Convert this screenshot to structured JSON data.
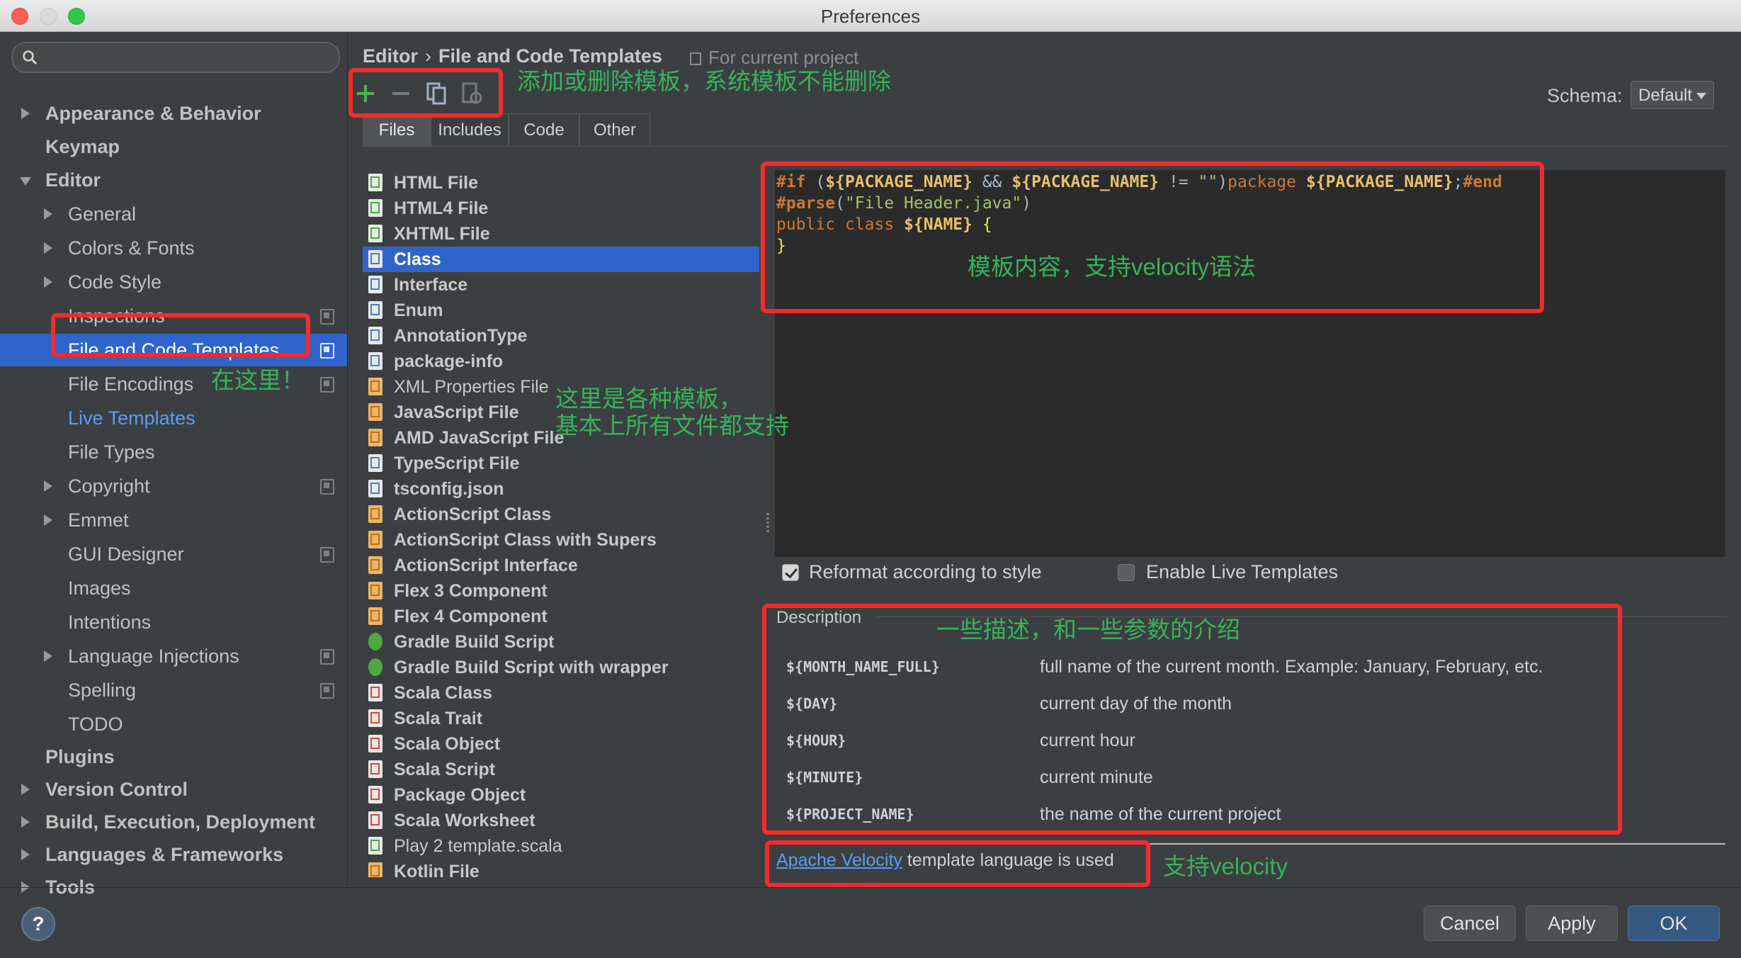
{
  "window": {
    "title": "Preferences"
  },
  "search": {
    "placeholder": ""
  },
  "sidebar": {
    "items": [
      {
        "label": "Appearance & Behavior"
      },
      {
        "label": "Keymap"
      },
      {
        "label": "Editor"
      },
      {
        "label": "General"
      },
      {
        "label": "Colors & Fonts"
      },
      {
        "label": "Code Style"
      },
      {
        "label": "Inspections"
      },
      {
        "label": "File and Code Templates"
      },
      {
        "label": "File Encodings"
      },
      {
        "label": "Live Templates"
      },
      {
        "label": "File Types"
      },
      {
        "label": "Copyright"
      },
      {
        "label": "Emmet"
      },
      {
        "label": "GUI Designer"
      },
      {
        "label": "Images"
      },
      {
        "label": "Intentions"
      },
      {
        "label": "Language Injections"
      },
      {
        "label": "Spelling"
      },
      {
        "label": "TODO"
      },
      {
        "label": "Plugins"
      },
      {
        "label": "Version Control"
      },
      {
        "label": "Build, Execution, Deployment"
      },
      {
        "label": "Languages & Frameworks"
      },
      {
        "label": "Tools"
      }
    ]
  },
  "breadcrumb": {
    "parent": "Editor",
    "separator": "›",
    "current": "File and Code Templates",
    "scope": "For current project"
  },
  "schema": {
    "label": "Schema:",
    "value": "Default"
  },
  "tabs": [
    {
      "label": "Files"
    },
    {
      "label": "Includes"
    },
    {
      "label": "Code"
    },
    {
      "label": "Other"
    }
  ],
  "templates": [
    "HTML File",
    "HTML4 File",
    "XHTML File",
    "Class",
    "Interface",
    "Enum",
    "AnnotationType",
    "package-info",
    "XML Properties File",
    "JavaScript File",
    "AMD JavaScript File",
    "TypeScript File",
    "tsconfig.json",
    "ActionScript Class",
    "ActionScript Class with Supers",
    "ActionScript Interface",
    "Flex 3 Component",
    "Flex 4 Component",
    "Gradle Build Script",
    "Gradle Build Script with wrapper",
    "Scala Class",
    "Scala Trait",
    "Scala Object",
    "Scala Script",
    "Package Object",
    "Scala Worksheet",
    "Play 2 template.scala",
    "Kotlin File"
  ],
  "editor": {
    "if_directive": "#if",
    "package_var": "${PACKAGE_NAME}",
    "and_op": "&&",
    "neq_op": "!=",
    "empty_string": "\"\"",
    "package_kw": "package",
    "end_directive": "#end",
    "parse_directive": "#parse",
    "parse_arg": "\"File Header.java\"",
    "public_kw": "public",
    "class_kw": "class",
    "name_var": "${NAME}",
    "open_brace": "{",
    "close_brace": "}"
  },
  "options": {
    "reformat": "Reformat according to style",
    "reformat_checked": true,
    "live_templates": "Enable Live Templates",
    "live_templates_checked": false
  },
  "description": {
    "title": "Description",
    "rows": [
      {
        "var": "${MONTH_NAME_FULL}",
        "text": "full name of the current month. Example: January, February, etc."
      },
      {
        "var": "${DAY}",
        "text": "current day of the month"
      },
      {
        "var": "${HOUR}",
        "text": "current hour"
      },
      {
        "var": "${MINUTE}",
        "text": "current minute"
      },
      {
        "var": "${PROJECT_NAME}",
        "text": "the name of the current project"
      }
    ]
  },
  "velocity": {
    "link": "Apache Velocity",
    "text": " template language is used"
  },
  "buttons": {
    "help": "?",
    "cancel": "Cancel",
    "apply": "Apply",
    "ok": "OK"
  },
  "annotations": {
    "toolbar_note": "添加或删除模板，系统模板不能删除",
    "here_note": "在这里！",
    "templates_note_1": "这里是各种模板，",
    "templates_note_2": "基本上所有文件都支持",
    "editor_note": "模板内容，支持velocity语法",
    "desc_note": "一些描述，和一些参数的介绍",
    "velocity_note": "支持velocity"
  },
  "colors": {
    "selection": "#2f65ca",
    "annotation_red": "#f52b2b",
    "annotation_green": "#35b35a"
  }
}
